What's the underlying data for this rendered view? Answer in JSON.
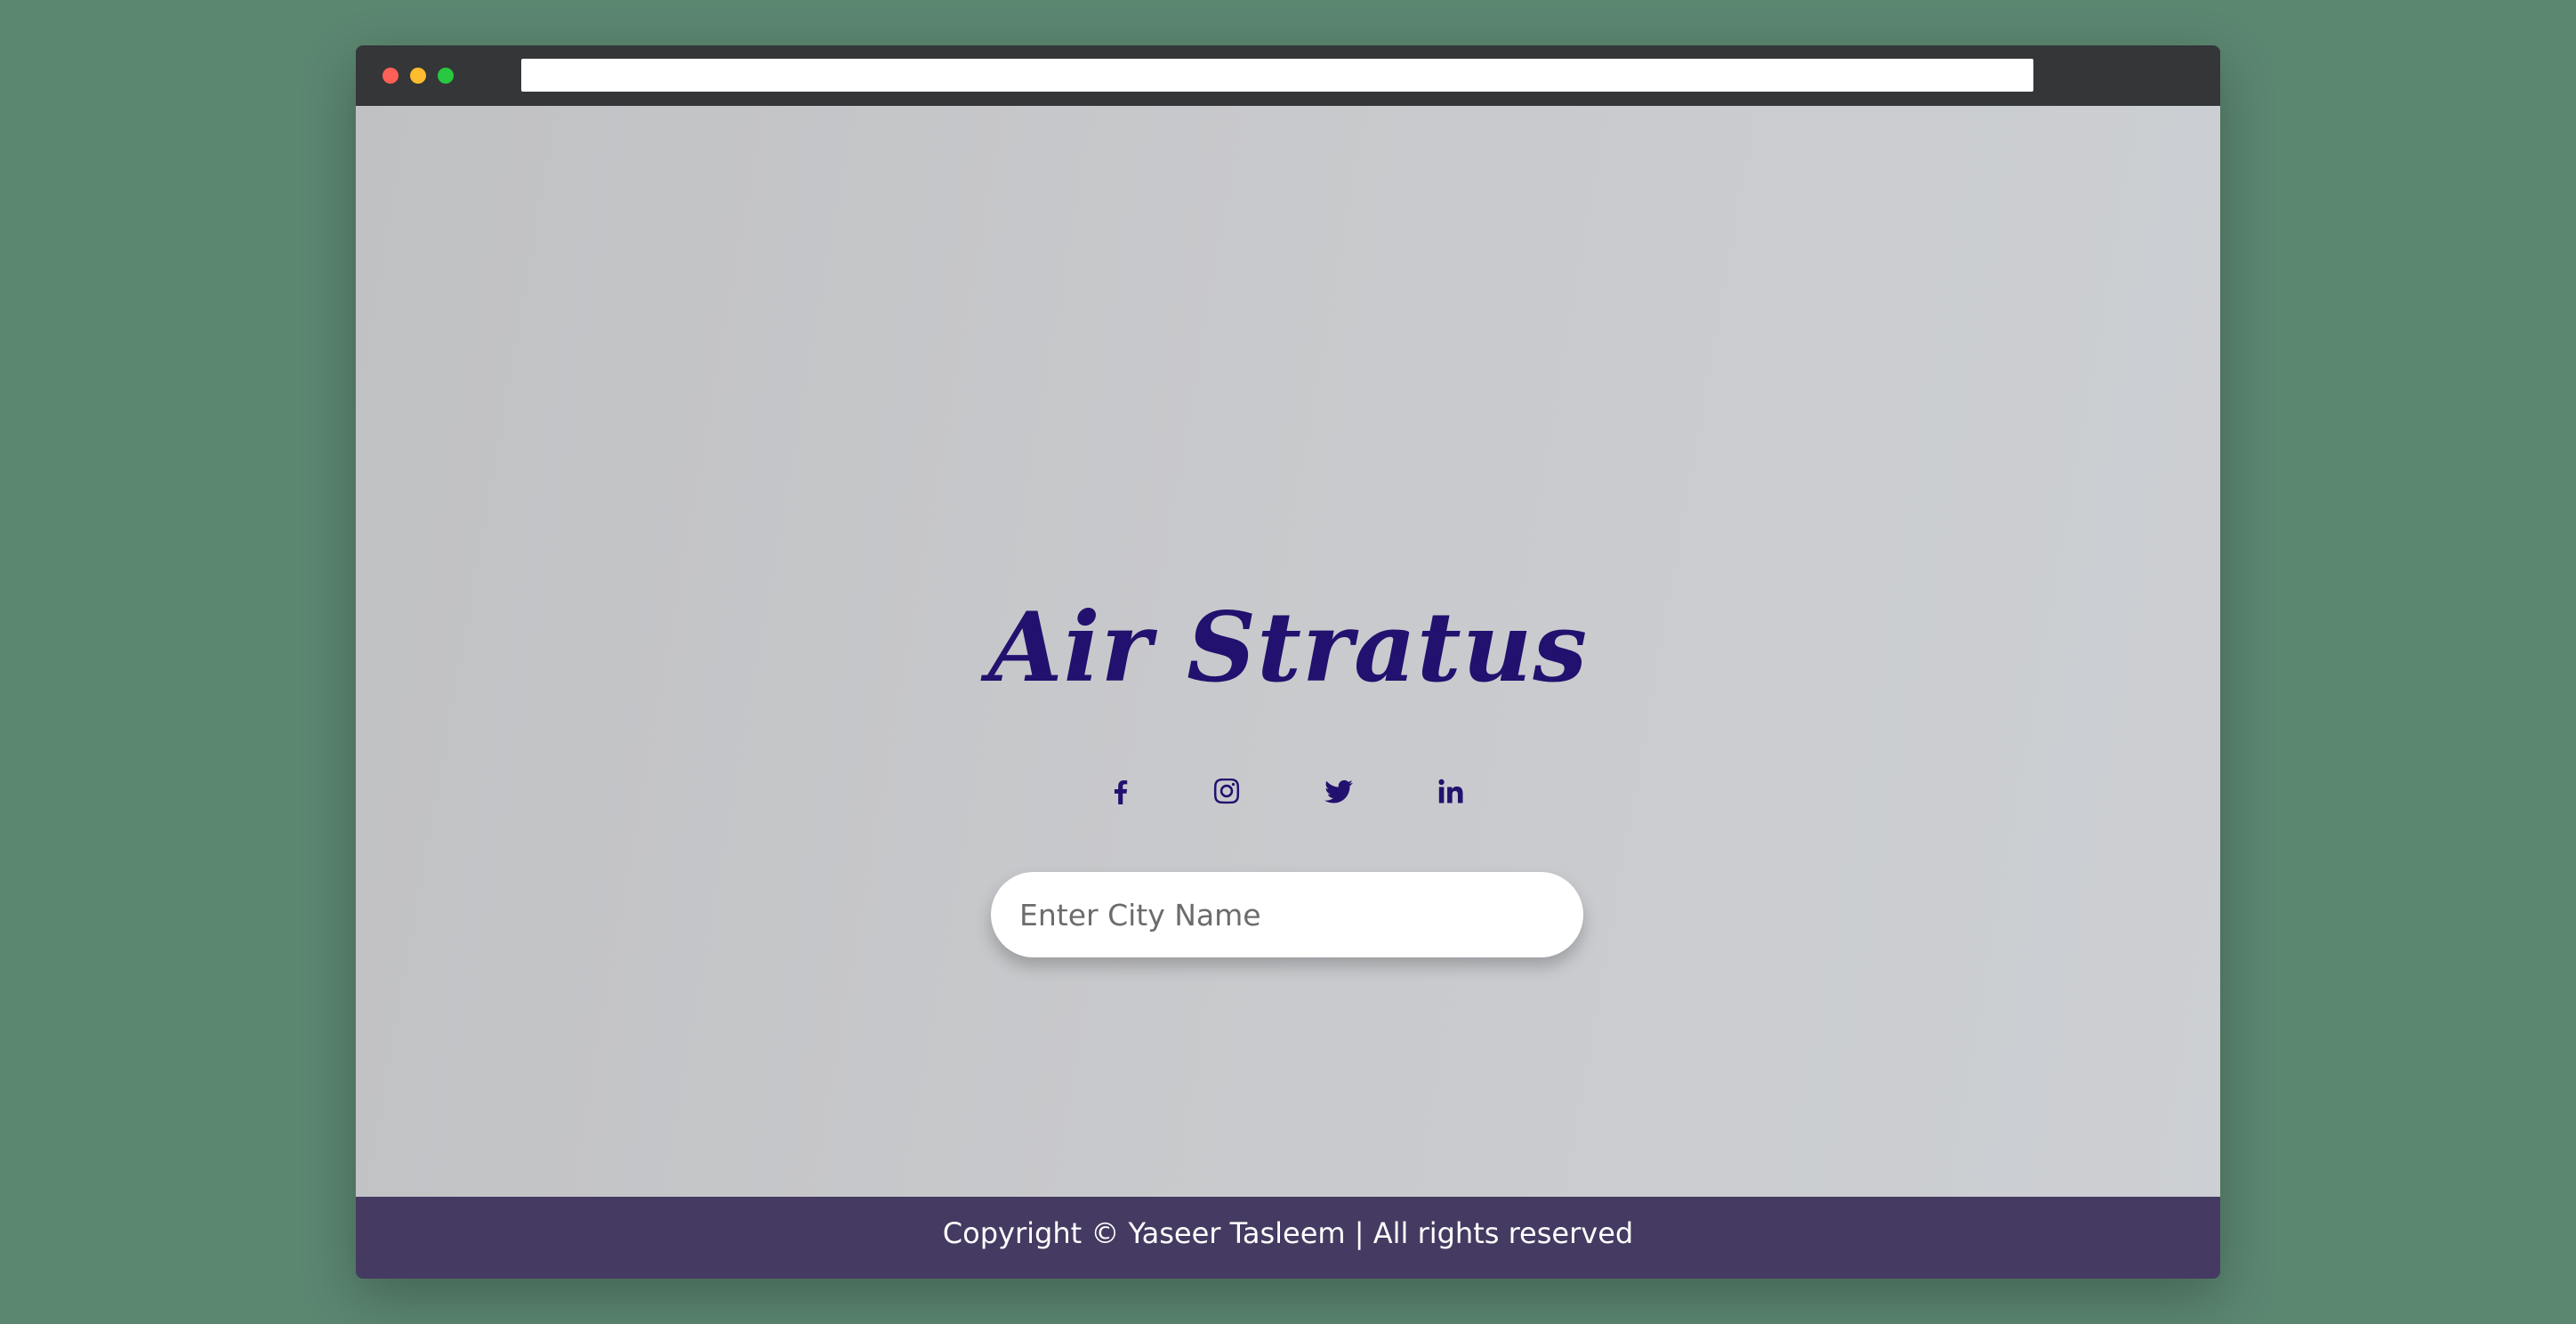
{
  "app": {
    "title": "Air Stratus"
  },
  "socials": [
    {
      "name": "facebook-icon"
    },
    {
      "name": "instagram-icon"
    },
    {
      "name": "twitter-icon"
    },
    {
      "name": "linkedin-icon"
    }
  ],
  "search": {
    "placeholder": "Enter City Name",
    "value": ""
  },
  "footer": {
    "text": "Copyright © Yaseer Tasleem | All rights reserved"
  },
  "colors": {
    "background": "#5b8670",
    "titlebar": "#343638",
    "accent": "#22116e",
    "footer": "#453a61"
  }
}
